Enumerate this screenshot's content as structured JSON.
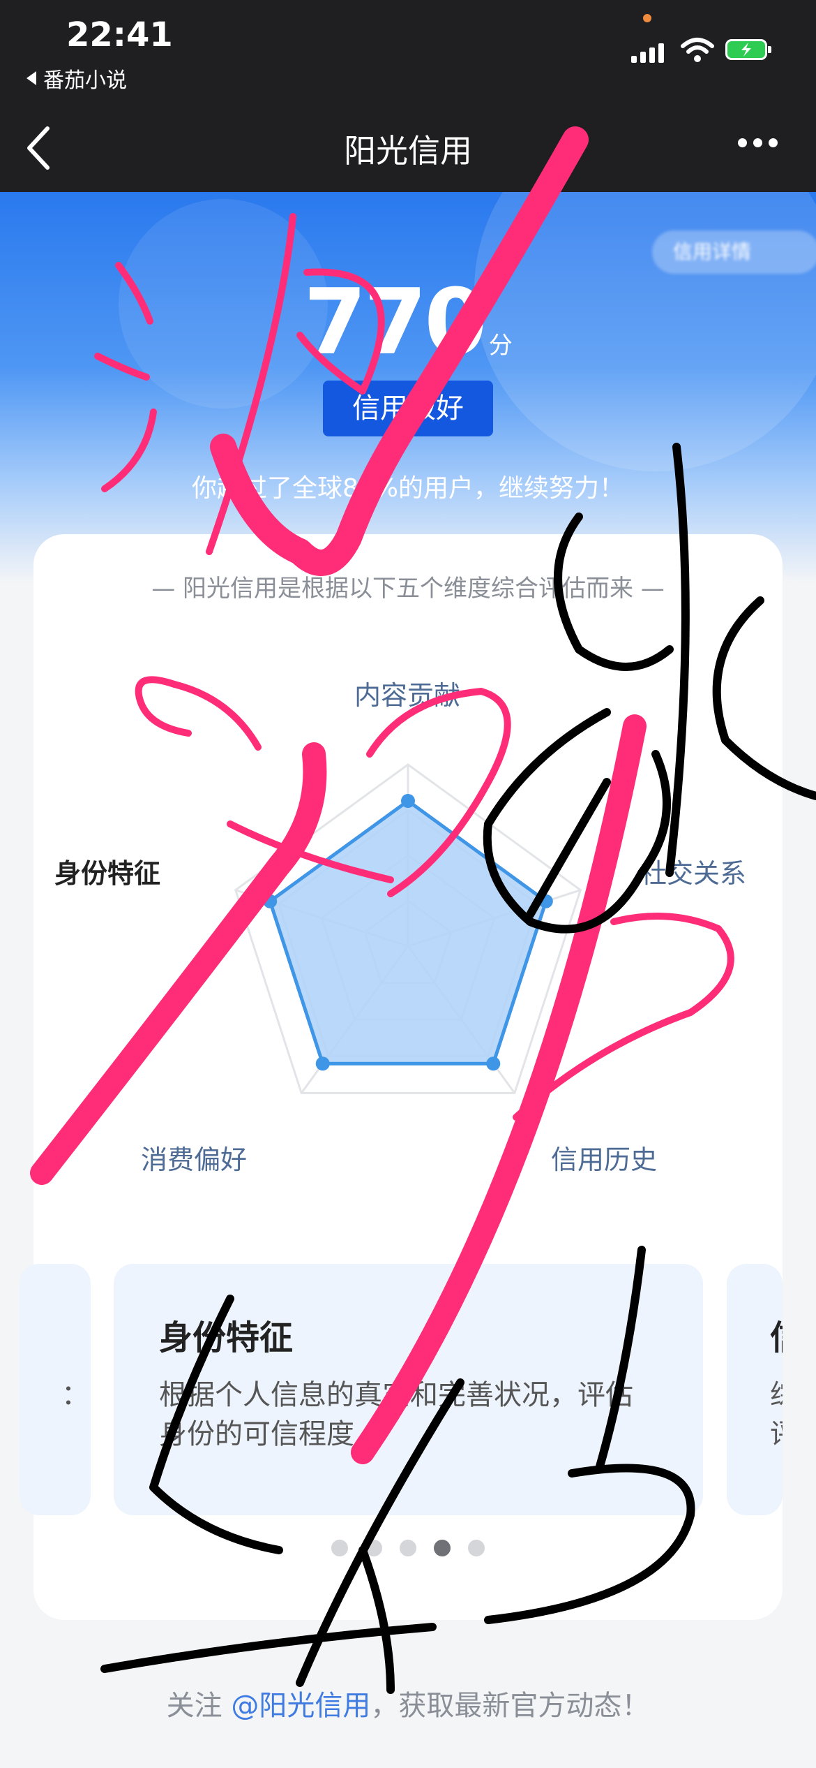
{
  "status_bar": {
    "time": "22:41",
    "back_app": "番茄小说"
  },
  "nav": {
    "title": "阳光信用"
  },
  "hero": {
    "score": "770",
    "score_unit": "分",
    "level": "信用极好",
    "beat_text": "你超过了全球87%的用户，继续努力！",
    "pill": "信用详情"
  },
  "card": {
    "subtitle": "— 阳光信用是根据以下五个维度综合评估而来 —",
    "dimensions": [
      {
        "label": "内容贡献",
        "value": 0.8
      },
      {
        "label": "社交关系",
        "value": 0.8
      },
      {
        "label": "信用历史",
        "value": 0.8
      },
      {
        "label": "消费偏好",
        "value": 0.8
      },
      {
        "label": "身份特征",
        "value": 0.8
      }
    ],
    "active_dimension": "身份特征",
    "tile": {
      "title": "身份特征",
      "desc": "根据个人信息的真实和完善状况，评估身份的可信程度"
    },
    "left_peek": {
      "desc": "："
    },
    "right_peek": {
      "title": "信",
      "desc": "综\n评"
    },
    "page_count": 5,
    "page_active": 4
  },
  "footer": {
    "prefix": "关注 ",
    "link": "@阳光信用",
    "suffix": "，获取最新官方动态！"
  },
  "colors": {
    "accent": "#1458e0",
    "radar_fill": "#b3d4f8",
    "radar_stroke": "#3f95e6",
    "pink_ink": "#ff2d78",
    "black_ink": "#000000"
  },
  "icons": [
    "back-arrow-icon",
    "more-icon",
    "signal-icon",
    "wifi-icon",
    "battery-icon"
  ]
}
